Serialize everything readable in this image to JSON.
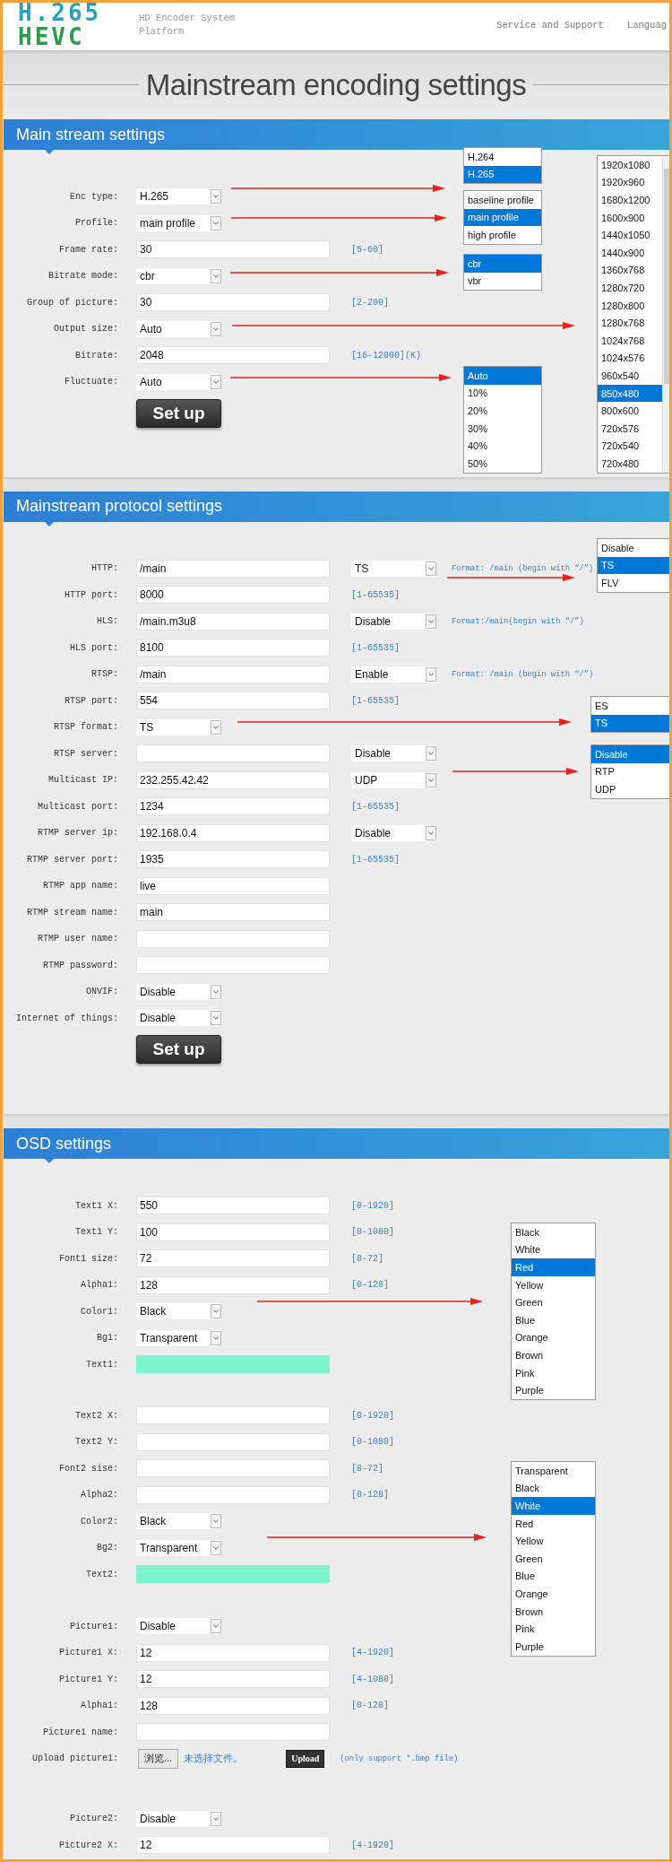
{
  "header": {
    "logo_top": "H.265",
    "logo_bottom": "HEVC",
    "platform": "HD Encoder System Platform",
    "nav": [
      "Service and Support",
      "Languag"
    ]
  },
  "page_title": "Mainstream encoding settings",
  "sections": [
    {
      "title": "Main stream settings",
      "button": "Set up",
      "groups": [
        [
          {
            "label": "Enc type:",
            "kind": "select",
            "value": "H.265"
          },
          {
            "label": "Profile:",
            "kind": "select",
            "value": "main profile"
          },
          {
            "label": "Frame rate:",
            "kind": "input",
            "value": "30",
            "hint": "[5-60]"
          },
          {
            "label": "Bitrate mode:",
            "kind": "select",
            "value": "cbr"
          },
          {
            "label": "Group of picture:",
            "kind": "input",
            "value": "30",
            "hint": "[2-200]"
          },
          {
            "label": "Output size:",
            "kind": "select",
            "value": "Auto"
          },
          {
            "label": "Bitrate:",
            "kind": "input",
            "value": "2048",
            "hint": "[16-12000](K)"
          },
          {
            "label": "Fluctuate:",
            "kind": "select",
            "value": "Auto"
          }
        ]
      ],
      "popups": [
        {
          "items": [
            {
              "label": "H.264",
              "selected": false
            },
            {
              "label": "H.265",
              "selected": true
            }
          ]
        },
        {
          "items": [
            {
              "label": "baseline profile",
              "selected": false
            },
            {
              "label": "main profile",
              "selected": true
            },
            {
              "label": "high profile",
              "selected": false
            }
          ]
        },
        {
          "items": [
            {
              "label": "cbr",
              "selected": true
            },
            {
              "label": "vbr",
              "selected": false
            }
          ]
        },
        {
          "items": [
            {
              "label": "Auto",
              "selected": true
            },
            {
              "label": "10%",
              "selected": false
            },
            {
              "label": "20%",
              "selected": false
            },
            {
              "label": "30%",
              "selected": false
            },
            {
              "label": "40%",
              "selected": false
            },
            {
              "label": "50%",
              "selected": false
            }
          ]
        },
        {
          "scrollbar": true,
          "items": [
            {
              "label": "1920x1080",
              "selected": false
            },
            {
              "label": "1920x960",
              "selected": false
            },
            {
              "label": "1680x1200",
              "selected": false
            },
            {
              "label": "1600x900",
              "selected": false
            },
            {
              "label": "1440x1050",
              "selected": false
            },
            {
              "label": "1440x900",
              "selected": false
            },
            {
              "label": "1360x768",
              "selected": false
            },
            {
              "label": "1280x720",
              "selected": false
            },
            {
              "label": "1280x800",
              "selected": false
            },
            {
              "label": "1280x768",
              "selected": false
            },
            {
              "label": "1024x768",
              "selected": false
            },
            {
              "label": "1024x576",
              "selected": false
            },
            {
              "label": "960x540",
              "selected": false
            },
            {
              "label": "850x480",
              "selected": true
            },
            {
              "label": "800x600",
              "selected": false
            },
            {
              "label": "720x576",
              "selected": false
            },
            {
              "label": "720x540",
              "selected": false
            },
            {
              "label": "720x480",
              "selected": false
            }
          ]
        }
      ]
    },
    {
      "title": "Mainstream protocol settings",
      "button": "Set up",
      "groups": [
        [
          {
            "label": "HTTP:",
            "kind": "input",
            "value": "/main",
            "select2": "TS",
            "note": "Format: /main (begin with “/”)"
          },
          {
            "label": "HTTP port:",
            "kind": "input",
            "value": "8000",
            "hint": "[1-65535]"
          },
          {
            "label": "HLS:",
            "kind": "input",
            "value": "/main.m3u8",
            "select2": "Disable",
            "note": "Format:/main(begin with “/”)"
          },
          {
            "label": "HLS port:",
            "kind": "input",
            "value": "8100",
            "hint": "[1-65535]"
          },
          {
            "label": "RTSP:",
            "kind": "input",
            "value": "/main",
            "select2": "Enable",
            "note": "Format: /main (begin with “/”)"
          },
          {
            "label": "RTSP port:",
            "kind": "input",
            "value": "554",
            "hint": "[1-65535]"
          },
          {
            "label": "RTSP format:",
            "kind": "select",
            "value": "TS"
          },
          {
            "label": "RTSP server:",
            "kind": "input",
            "select2": "Disable"
          },
          {
            "label": "Multicast IP:",
            "kind": "input",
            "value": "232.255.42.42",
            "select2": "UDP"
          },
          {
            "label": "Multicast port:",
            "kind": "input",
            "value": "1234",
            "hint": "[1-65535]"
          },
          {
            "label": "RTMP server ip:",
            "kind": "input",
            "value": "192.168.0.4",
            "select2": "Disable"
          },
          {
            "label": "RTMP server port:",
            "kind": "input",
            "value": "1935",
            "hint": "[1-65535]"
          },
          {
            "label": "RTMP app name:",
            "kind": "input",
            "value": "live"
          },
          {
            "label": "RTMP stream name:",
            "kind": "input",
            "value": "main"
          },
          {
            "label": "RTMP user name:",
            "kind": "input"
          },
          {
            "label": "RTMP password:",
            "kind": "input"
          },
          {
            "label": "ONVIF:",
            "kind": "select",
            "value": "Disable"
          },
          {
            "label": "Internet of things:",
            "kind": "select",
            "value": "Disable"
          }
        ]
      ],
      "popups": [
        {
          "items": [
            {
              "label": "Disable",
              "selected": false
            },
            {
              "label": "TS",
              "selected": true
            },
            {
              "label": "FLV",
              "selected": false
            }
          ]
        },
        {
          "items": [
            {
              "label": "ES",
              "selected": false
            },
            {
              "label": "TS",
              "selected": true
            }
          ]
        },
        {
          "items": [
            {
              "label": "Disable",
              "selected": true
            },
            {
              "label": "RTP",
              "selected": false
            },
            {
              "label": "UDP",
              "selected": false
            }
          ]
        }
      ]
    },
    {
      "title": "OSD settings",
      "groups": [
        [
          {
            "label": "Text1 X:",
            "kind": "input",
            "value": "550",
            "hint": "[0-1920]"
          },
          {
            "label": "Text1 Y:",
            "kind": "input",
            "value": "100",
            "hint": "[0-1080]"
          },
          {
            "label": "Font1 size:",
            "kind": "input",
            "value": "72",
            "hint": "[8-72]"
          },
          {
            "label": "Alpha1:",
            "kind": "input",
            "value": "128",
            "hint": "[0-128]"
          },
          {
            "label": "Color1:",
            "kind": "select",
            "value": "Black"
          },
          {
            "label": "Bg1:",
            "kind": "select",
            "value": "Transparent"
          },
          {
            "label": "Text1:",
            "kind": "swatch"
          }
        ],
        [
          {
            "label": "Text2 X:",
            "kind": "input",
            "hint": "[0-1920]"
          },
          {
            "label": "Text2 Y:",
            "kind": "input",
            "hint": "[0-1080]"
          },
          {
            "label": "Font2 sise:",
            "kind": "input",
            "hint": "[8-72]"
          },
          {
            "label": "Alpha2:",
            "kind": "input",
            "hint": "[0-128]"
          },
          {
            "label": "Color2:",
            "kind": "select",
            "value": "Black"
          },
          {
            "label": "Bg2:",
            "kind": "select",
            "value": "Transparent"
          },
          {
            "label": "Text2:",
            "kind": "swatch"
          }
        ],
        [
          {
            "label": "Picture1:",
            "kind": "select",
            "value": "Disable"
          },
          {
            "label": "Picture1 X:",
            "kind": "input",
            "value": "12",
            "hint": "[4-1920]"
          },
          {
            "label": "Picture1 Y:",
            "kind": "input",
            "value": "12",
            "hint": "[4-1080]"
          },
          {
            "label": "Alpha1:",
            "kind": "input",
            "value": "128",
            "hint": "[0-128]"
          },
          {
            "label": "Picture1 name:",
            "kind": "input"
          },
          {
            "label": "Upload picture1:",
            "kind": "file",
            "browse": "浏览...",
            "status": "未选择文件。",
            "upload": "Upload",
            "note": "(only support *.bmp file)"
          }
        ],
        [
          {
            "label": "Picture2:",
            "kind": "select",
            "value": "Disable"
          },
          {
            "label": "Picture2 X:",
            "kind": "input",
            "value": "12",
            "hint": "[4-1920]"
          }
        ]
      ],
      "popups": [
        {
          "items": [
            {
              "label": "Black",
              "selected": false
            },
            {
              "label": "White",
              "selected": false
            },
            {
              "label": "Red",
              "selected": true
            },
            {
              "label": "Yellow",
              "selected": false
            },
            {
              "label": "Green",
              "selected": false
            },
            {
              "label": "Blue",
              "selected": false
            },
            {
              "label": "Orange",
              "selected": false
            },
            {
              "label": "Brown",
              "selected": false
            },
            {
              "label": "Pink",
              "selected": false
            },
            {
              "label": "Purple",
              "selected": false
            }
          ]
        },
        {
          "items": [
            {
              "label": "Transparent",
              "selected": false
            },
            {
              "label": "Black",
              "selected": false
            },
            {
              "label": "White",
              "selected": true
            },
            {
              "label": "Red",
              "selected": false
            },
            {
              "label": "Yellow",
              "selected": false
            },
            {
              "label": "Green",
              "selected": false
            },
            {
              "label": "Blue",
              "selected": false
            },
            {
              "label": "Orange",
              "selected": false
            },
            {
              "label": "Brown",
              "selected": false
            },
            {
              "label": "Pink",
              "selected": false
            },
            {
              "label": "Purple",
              "selected": false
            }
          ]
        }
      ]
    }
  ]
}
